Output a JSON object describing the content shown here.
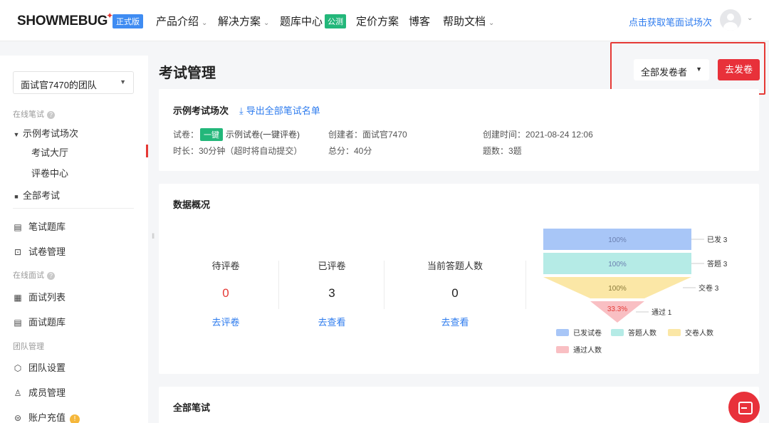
{
  "header": {
    "logo": "SHOWMEBUG",
    "edition_badge": "正式版",
    "nav": [
      {
        "label": "产品介绍",
        "has_dropdown": true
      },
      {
        "label": "解决方案",
        "has_dropdown": true
      },
      {
        "label": "题库中心",
        "badge": "公测"
      },
      {
        "label": "定价方案"
      },
      {
        "label": "博客"
      },
      {
        "label": "帮助文档",
        "has_dropdown": true
      }
    ],
    "cta": "点击获取笔面试场次"
  },
  "sidebar": {
    "team": "面试官7470的团队",
    "group_written": "在线笔试",
    "exam_session": "示例考试场次",
    "exam_hall": "考试大厅",
    "grading_center": "评卷中心",
    "all_exams": "全部考试",
    "question_bank": "笔试题库",
    "paper_management": "试卷管理",
    "group_interview": "在线面试",
    "interview_list": "面试列表",
    "interview_bank": "面试题库",
    "group_team": "团队管理",
    "team_settings": "团队设置",
    "member_management": "成员管理",
    "account_recharge": "账户充值",
    "warn_mark": "!"
  },
  "main": {
    "title": "考试管理",
    "issuer_filter": "全部发卷者",
    "send_button": "去发卷",
    "exam": {
      "title": "示例考试场次",
      "export_link": "导出全部笔试名单",
      "paper_label": "试卷：",
      "paper_tag": "一键",
      "paper_name": "示例试卷(一键评卷)",
      "creator": "创建者：面试官7470",
      "created_at": "创建时间：2021-08-24 12:06",
      "duration": "时长：30分钟（超时将自动提交）",
      "total_score": "总分：40分",
      "question_count": "题数：3题"
    },
    "overview": {
      "title": "数据概况",
      "stats": [
        {
          "label": "待评卷",
          "value": "0",
          "link": "去评卷"
        },
        {
          "label": "已评卷",
          "value": "3",
          "link": "去查看"
        },
        {
          "label": "当前答题人数",
          "value": "0",
          "link": "去查看"
        }
      ]
    },
    "all_written_title": "全部笔试"
  },
  "chart_data": {
    "type": "funnel",
    "stages": [
      {
        "name": "已发试卷",
        "label": "已发",
        "count": 3,
        "percent": "100%",
        "color": "#a8c6f7"
      },
      {
        "name": "答题人数",
        "label": "答题",
        "count": 3,
        "percent": "100%",
        "color": "#b5ebe6"
      },
      {
        "name": "交卷人数",
        "label": "交卷",
        "count": 3,
        "percent": "100%",
        "color": "#fbe7a6"
      },
      {
        "name": "通过人数",
        "label": "通过",
        "count": 1,
        "percent": "33.3%",
        "color": "#f9bfc3"
      }
    ],
    "legend_position": "bottom"
  }
}
